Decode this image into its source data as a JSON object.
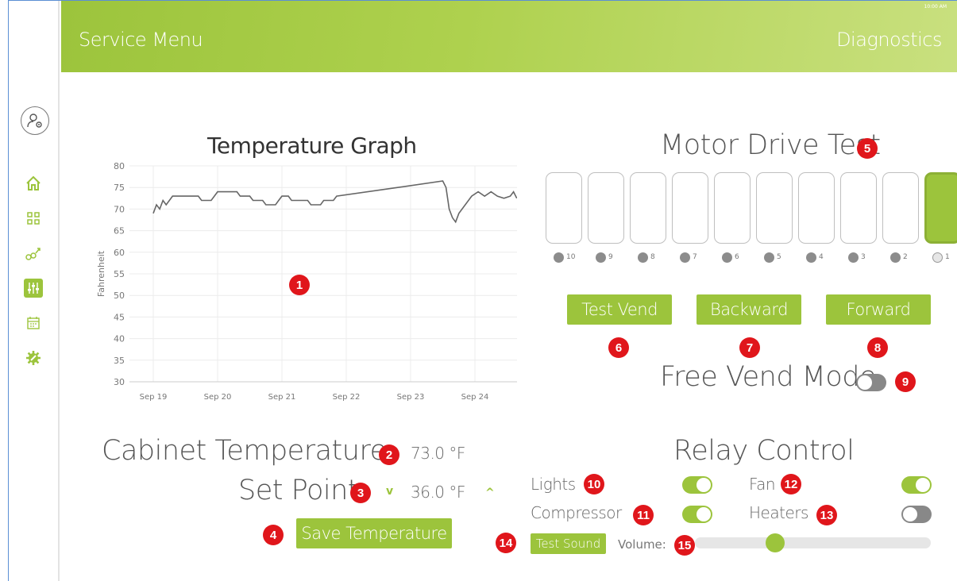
{
  "header": {
    "left_title": "Service Menu",
    "right_title": "Diagnostics",
    "status": "10:00 AM"
  },
  "sidebar": {
    "items": [
      {
        "icon": "user-gear-icon"
      },
      {
        "icon": "home-icon"
      },
      {
        "icon": "grid-icon"
      },
      {
        "icon": "sales-chart-icon"
      },
      {
        "icon": "sliders-icon",
        "active": true
      },
      {
        "icon": "calendar-icon"
      },
      {
        "icon": "gear-wrench-icon"
      }
    ]
  },
  "temperature_graph": {
    "title": "Temperature Graph",
    "badge": "1"
  },
  "chart_data": {
    "type": "line",
    "title": "Temperature Graph",
    "ylabel": "Fahrenheit",
    "xlabel": "",
    "ylim": [
      30,
      80
    ],
    "yticks": [
      "80",
      "75",
      "70",
      "65",
      "60",
      "55",
      "50",
      "45",
      "40",
      "35",
      "30"
    ],
    "xticks": [
      "Sep 19",
      "Sep 20",
      "Sep 21",
      "Sep 22",
      "Sep 23",
      "Sep 24"
    ],
    "grid": true,
    "series": [
      {
        "color": "#666666",
        "points": [
          [
            0,
            69
          ],
          [
            0.05,
            71
          ],
          [
            0.1,
            70
          ],
          [
            0.15,
            72
          ],
          [
            0.2,
            71
          ],
          [
            0.25,
            72
          ],
          [
            0.3,
            73
          ],
          [
            0.5,
            73
          ],
          [
            0.7,
            73
          ],
          [
            0.75,
            72
          ],
          [
            0.9,
            72
          ],
          [
            0.95,
            73
          ],
          [
            1.0,
            74
          ],
          [
            1.3,
            74
          ],
          [
            1.35,
            73
          ],
          [
            1.5,
            73
          ],
          [
            1.55,
            72
          ],
          [
            1.7,
            72
          ],
          [
            1.75,
            71
          ],
          [
            1.9,
            71
          ],
          [
            1.95,
            72
          ],
          [
            2.0,
            73
          ],
          [
            2.1,
            73
          ],
          [
            2.15,
            72
          ],
          [
            2.4,
            72
          ],
          [
            2.45,
            71
          ],
          [
            2.6,
            71
          ],
          [
            2.65,
            72
          ],
          [
            2.8,
            72
          ],
          [
            2.85,
            73
          ],
          [
            3.8,
            75
          ],
          [
            4.5,
            76.5
          ],
          [
            4.55,
            75
          ],
          [
            4.6,
            70
          ],
          [
            4.65,
            68
          ],
          [
            4.7,
            67
          ],
          [
            4.75,
            69
          ],
          [
            4.85,
            71
          ],
          [
            4.95,
            73
          ],
          [
            5.05,
            74
          ],
          [
            5.15,
            73
          ],
          [
            5.25,
            74
          ],
          [
            5.35,
            73
          ],
          [
            5.45,
            72.5
          ],
          [
            5.55,
            73
          ],
          [
            5.6,
            74
          ],
          [
            5.65,
            72.5
          ]
        ]
      }
    ]
  },
  "cabinet": {
    "label": "Cabinet Temperature",
    "value": "73.0 °F",
    "badge": "2"
  },
  "set_point": {
    "label": "Set Point",
    "value": "36.0 °F",
    "badge": "3",
    "down": "v",
    "up": "^"
  },
  "save": {
    "label": "Save Temperature",
    "badge": "4"
  },
  "motor": {
    "title": "Motor Drive Test",
    "badge": "5",
    "slots": [
      "10",
      "9",
      "8",
      "7",
      "6",
      "5",
      "4",
      "3",
      "2",
      "1"
    ],
    "selected_slot": "1"
  },
  "buttons": [
    {
      "label": "Test Vend",
      "badge": "6"
    },
    {
      "label": "Backward",
      "badge": "7"
    },
    {
      "label": "Forward",
      "badge": "8"
    }
  ],
  "free_vend": {
    "label": "Free Vend Mode",
    "badge": "9",
    "on": false
  },
  "relay": {
    "title": "Relay Control",
    "items": [
      {
        "label": "Lights",
        "badge": "10",
        "on": true
      },
      {
        "label": "Compressor",
        "badge": "11",
        "on": true
      },
      {
        "label": "Fan",
        "badge": "12",
        "on": true
      },
      {
        "label": "Heaters",
        "badge": "13",
        "on": false
      }
    ]
  },
  "sound": {
    "button": "Test Sound",
    "badge": "14",
    "volume_label": "Volume:",
    "volume_badge": "15",
    "volume": 0.34
  },
  "colors": {
    "accent": "#9cc43c",
    "badge": "#e0161b"
  }
}
